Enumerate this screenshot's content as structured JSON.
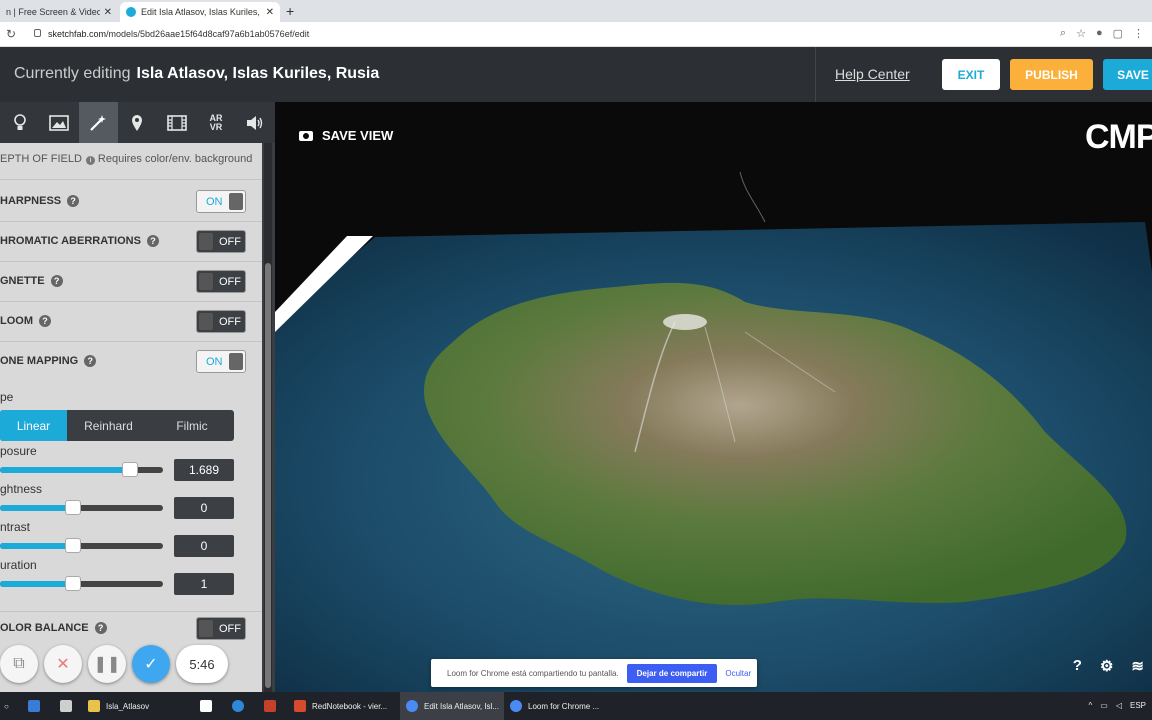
{
  "browser": {
    "tabs": [
      {
        "title": "n | Free Screen & Video Rec",
        "active": false
      },
      {
        "title": "Edit Isla Atlasov, Islas Kuriles, Ru",
        "active": true
      }
    ],
    "new_tab": "+",
    "url_host": "sketchfab.com",
    "url_path": "/models/5bd26aae15f64d8caf97a6b1ab0576ef/edit"
  },
  "header": {
    "editing_prefix": "Currently editing",
    "model_name": "Isla Atlasov, Islas Kuriles, Rusia",
    "help_link": "Help Center",
    "exit_label": "EXIT",
    "publish_label": "PUBLISH",
    "save_label": "SAVE"
  },
  "toolbar": {
    "icons": [
      "lighting-icon",
      "background-icon",
      "post-processing-icon",
      "annotations-icon",
      "animation-icon",
      "arvr-icon",
      "sound-icon"
    ],
    "arvr_text": "AR\nVR"
  },
  "post_processing": {
    "dof_label": "EPTH OF FIELD",
    "dof_note": "Requires color/env. background",
    "filters": [
      {
        "label": "HARPNESS",
        "state": "ON"
      },
      {
        "label": "HROMATIC ABERRATIONS",
        "state": "OFF"
      },
      {
        "label": "GNETTE",
        "state": "OFF"
      },
      {
        "label": "LOOM",
        "state": "OFF"
      },
      {
        "label": "ONE MAPPING",
        "state": "ON"
      }
    ],
    "tone_type_label": "pe",
    "tone_types": [
      "Linear",
      "Reinhard",
      "Filmic"
    ],
    "tone_selected": "Linear",
    "sliders": [
      {
        "label": "posure",
        "value": "1.689",
        "level": 0.8
      },
      {
        "label": "ghtness",
        "value": "0",
        "level": 0.45
      },
      {
        "label": "ntrast",
        "value": "0",
        "level": 0.45
      },
      {
        "label": "uration",
        "value": "1",
        "level": 0.45
      }
    ],
    "color_balance": {
      "label": "OLOR BALANCE",
      "state": "OFF"
    }
  },
  "loom_controls": {
    "timer": "5:46"
  },
  "viewport": {
    "save_view": "SAVE VIEW",
    "watermark": "CMP",
    "help_icon_text": "?"
  },
  "loom_banner": {
    "message": "Loom for Chrome está compartiendo tu pantalla.",
    "stop_button": "Dejar de compartir",
    "hide_link": "Ocultar"
  },
  "taskbar": {
    "items": [
      {
        "label": "Isla_Atlasov",
        "color": "#e8c24a"
      },
      {
        "label": "RedNotebook - vier...",
        "color": "#d64a2e"
      },
      {
        "label": "Edit Isla Atlasov, Isl...",
        "color": "#4a8af4",
        "active": true
      },
      {
        "label": "Loom for Chrome ...",
        "color": "#4a8af4"
      }
    ],
    "language": "ESP"
  },
  "colors": {
    "accent": "#1caad9",
    "publish": "#fbb03b",
    "header_bg": "#2c2f33"
  }
}
